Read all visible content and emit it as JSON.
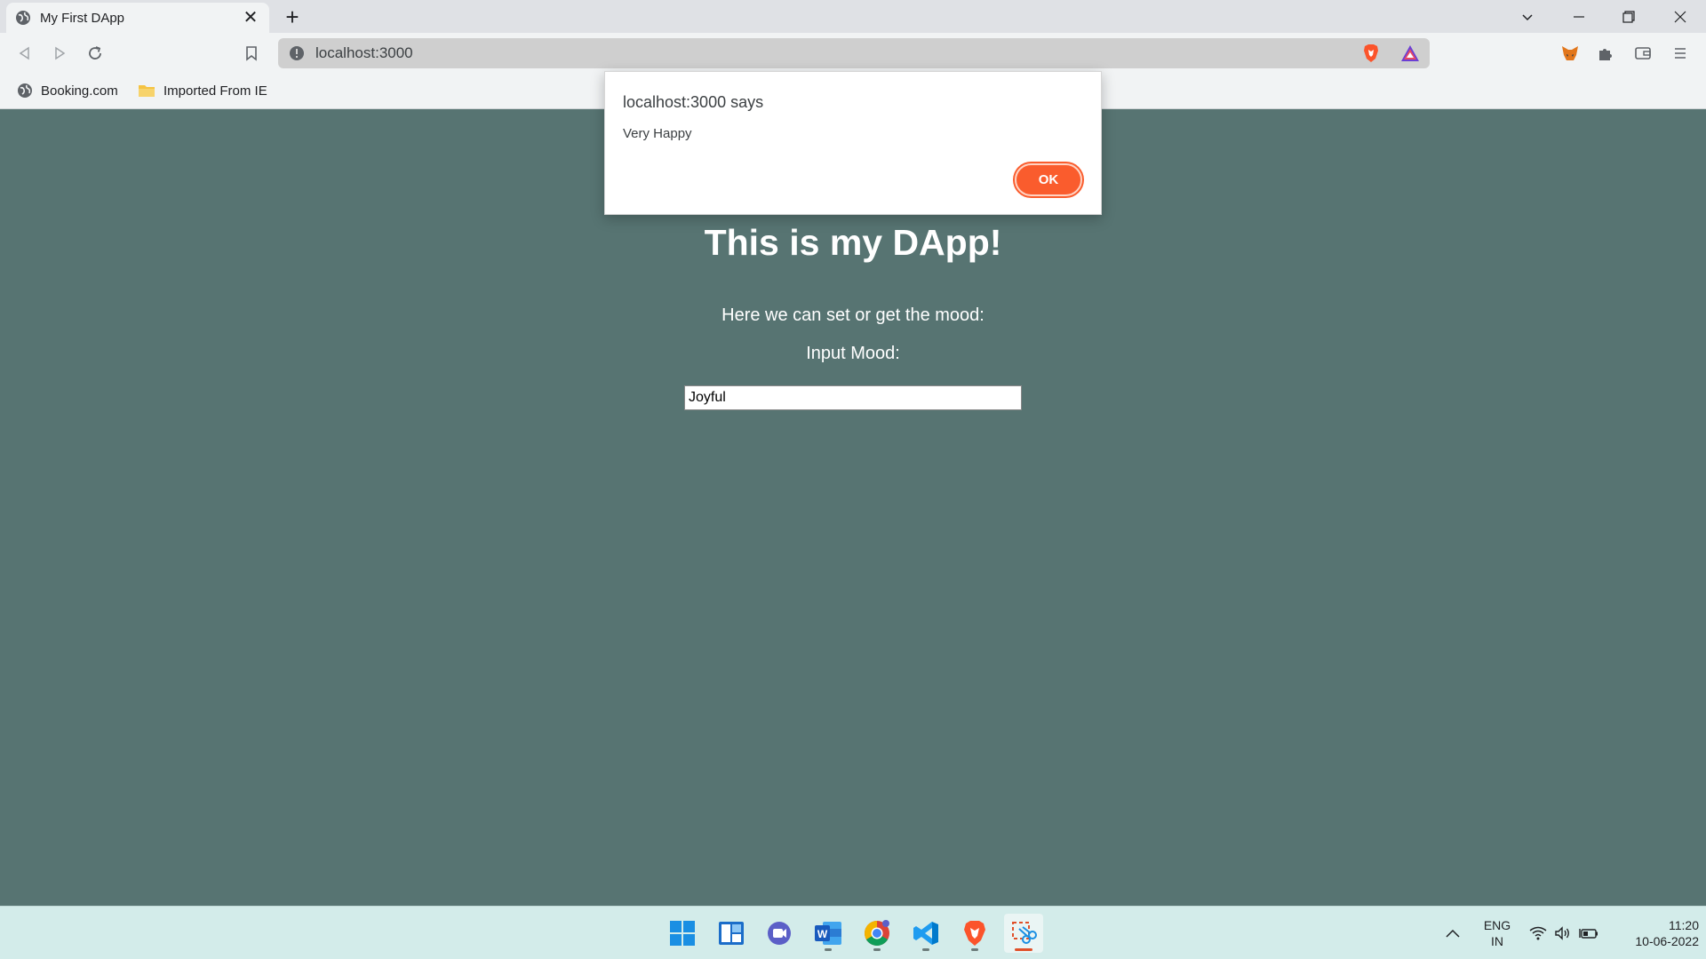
{
  "browser": {
    "tab_title": "My First DApp",
    "tab_close": "✕",
    "new_tab": "+",
    "url": "localhost:3000",
    "bookmarks": [
      "Booking.com",
      "Imported From IE"
    ]
  },
  "page": {
    "heading": "This is my DApp!",
    "subtitle": "Here we can set or get the mood:",
    "input_label": "Input Mood:",
    "input_value": "Joyful",
    "background": "#577472"
  },
  "dialog": {
    "title": "localhost:3000 says",
    "message": "Very Happy",
    "ok_label": "OK",
    "ok_color": "#fa5c2d"
  },
  "taskbar": {
    "apps": [
      "windows-start-icon",
      "widgets-icon",
      "teams-chat-icon",
      "word-icon",
      "chrome-icon",
      "vscode-icon",
      "brave-icon",
      "snipping-tool-icon"
    ],
    "language": "ENG",
    "region": "IN",
    "time": "11:20",
    "date": "10-06-2022"
  }
}
